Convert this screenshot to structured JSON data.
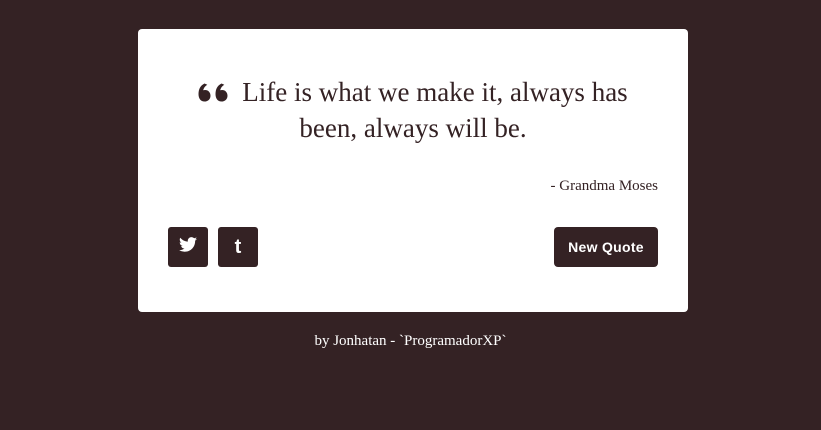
{
  "quote": {
    "text": "Life is what we make it, always has been, always will be.",
    "author": "- Grandma Moses",
    "mark_icon": "quote-left-icon"
  },
  "actions": {
    "twitter_icon": "twitter-icon",
    "tumblr_icon": "tumblr-icon",
    "tumblr_glyph": "t",
    "new_quote_label": "New Quote"
  },
  "footer": {
    "credit": "by Jonhatan - `ProgramadorXP`"
  },
  "colors": {
    "background": "#342224",
    "card": "#ffffff",
    "accent": "#342224"
  }
}
